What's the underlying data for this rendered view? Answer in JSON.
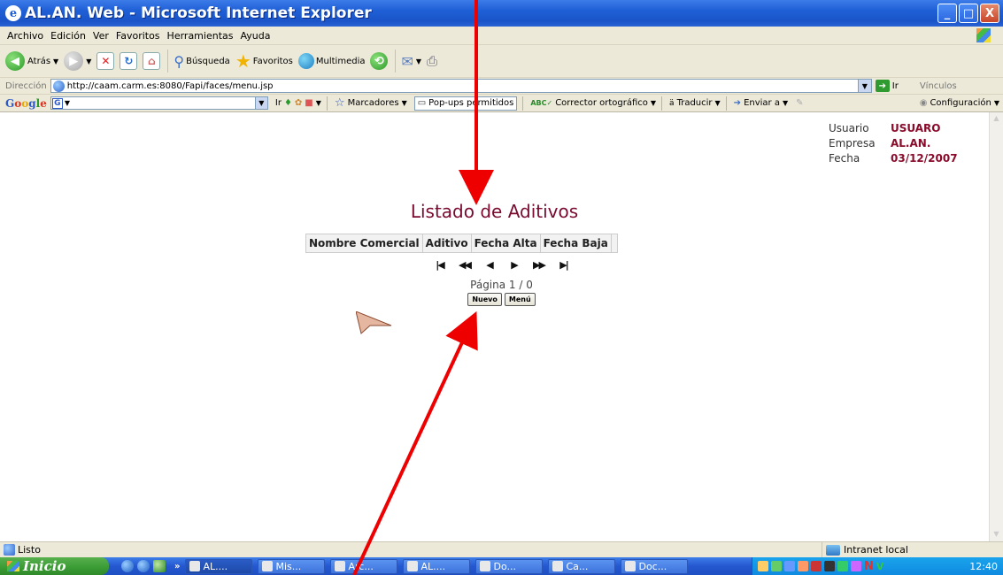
{
  "window": {
    "title": "AL.AN. Web - Microsoft Internet Explorer",
    "buttons": [
      "_",
      "□",
      "X"
    ]
  },
  "menu": [
    "Archivo",
    "Edición",
    "Ver",
    "Favoritos",
    "Herramientas",
    "Ayuda"
  ],
  "toolbar": {
    "back": "Atrás",
    "search": "Búsqueda",
    "favorites": "Favoritos",
    "multimedia": "Multimedia"
  },
  "address": {
    "label": "Dirección",
    "url": "http://caam.carm.es:8080/Fapi/faces/menu.jsp",
    "go": "Ir",
    "links": "Vínculos"
  },
  "google_toolbar": {
    "go": "Ir",
    "bookmarks": "Marcadores",
    "popups": "Pop-ups permitidos",
    "spell": "Corrector ortográfico",
    "translate": "Traducir",
    "send": "Enviar a",
    "settings": "Configuración"
  },
  "user_info": [
    {
      "key": "Usuario",
      "value": "USUARO"
    },
    {
      "key": "Empresa",
      "value": "AL.AN."
    },
    {
      "key": "Fecha",
      "value": "03/12/2007"
    }
  ],
  "page": {
    "title": "Listado de Aditivos",
    "columns": [
      "Nombre Comercial",
      "Aditivo",
      "Fecha Alta",
      "Fecha Baja"
    ],
    "pager": [
      "|◀",
      "◀◀",
      "◀",
      "▶",
      "▶▶",
      "▶|"
    ],
    "page_info": "Página 1 / 0",
    "btn_new": "Nuevo",
    "btn_menu": "Menú"
  },
  "status": {
    "text": "Listo",
    "zone": "Intranet local"
  },
  "taskbar": {
    "start": "Inicio",
    "tasks": [
      "AL....",
      "Mis...",
      "Arc...",
      "AL....",
      "Do...",
      "Ca...",
      "Doc..."
    ],
    "clock": "12:40"
  },
  "colors": {
    "title_accent": "#7a0a2e",
    "annotation": "#ee0000"
  }
}
